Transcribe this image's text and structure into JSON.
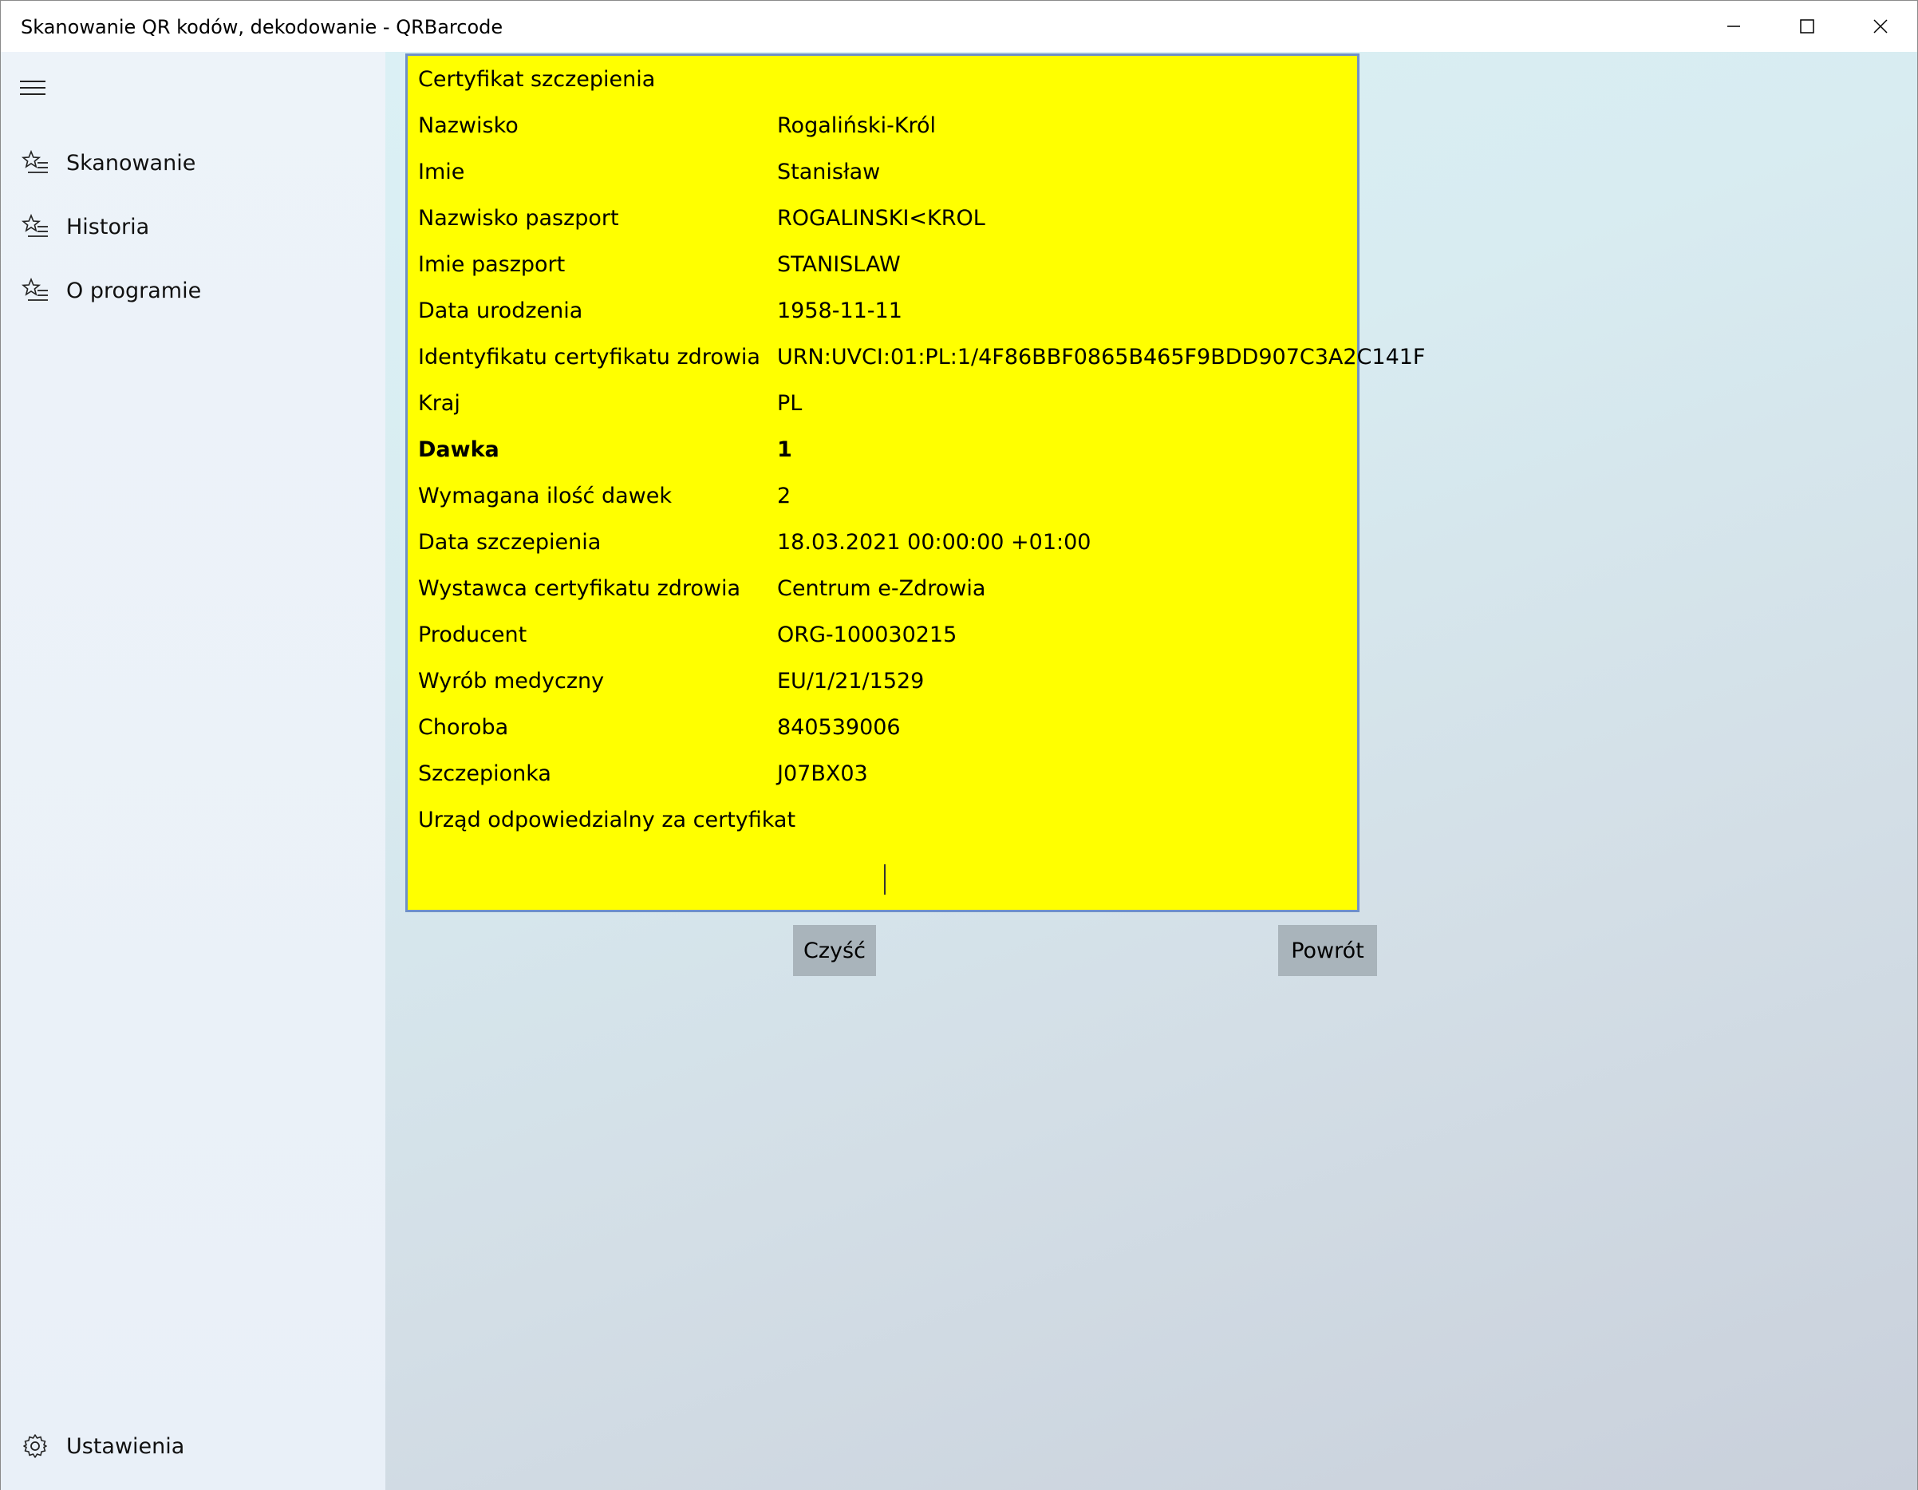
{
  "window": {
    "title": "Skanowanie QR kodów, dekodowanie - QRBarcode"
  },
  "sidebar": {
    "items": [
      {
        "label": "Skanowanie",
        "icon": "star-list-icon"
      },
      {
        "label": "Historia",
        "icon": "star-list-icon"
      },
      {
        "label": "O programie",
        "icon": "star-list-icon"
      }
    ],
    "settings_label": "Ustawienia"
  },
  "certificate": {
    "title": "Certyfikat szczepienia",
    "background": "#ffff00",
    "rows": [
      {
        "label": "Nazwisko",
        "value": "Rogaliński-Król"
      },
      {
        "label": "Imie",
        "value": "Stanisław"
      },
      {
        "label": "Nazwisko paszport",
        "value": "ROGALINSKI<KROL"
      },
      {
        "label": "Imie paszport",
        "value": "STANISLAW"
      },
      {
        "label": "Data urodzenia",
        "value": "1958-11-11"
      },
      {
        "label": "Identyfikatu certyfikatu zdrowia",
        "value": "URN:UVCI:01:PL:1/4F86BBF0865B465F9BDD907C3A2C141F"
      },
      {
        "label": "Kraj",
        "value": "PL"
      },
      {
        "label": "Dawka",
        "value": "1"
      },
      {
        "label": "Wymagana ilość dawek",
        "value": "2"
      },
      {
        "label": "Data szczepienia",
        "value": "18.03.2021 00:00:00 +01:00"
      },
      {
        "label": "Wystawca certyfikatu zdrowia",
        "value": "Centrum e-Zdrowia"
      },
      {
        "label": "Producent",
        "value": "ORG-100030215"
      },
      {
        "label": "Wyrób medyczny",
        "value": "EU/1/21/1529"
      },
      {
        "label": "Choroba",
        "value": "840539006"
      },
      {
        "label": "Szczepionka",
        "value": "J07BX03"
      },
      {
        "label": "Urząd odpowiedzialny za certyfikat",
        "value": ""
      }
    ]
  },
  "buttons": {
    "clear_label": "Czyść",
    "back_label": "Powrót"
  }
}
